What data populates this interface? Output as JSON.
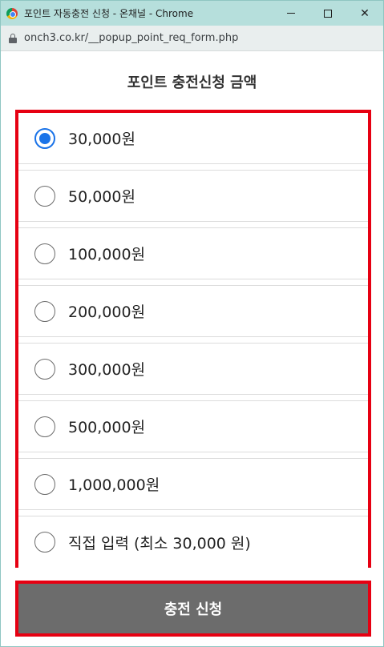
{
  "window": {
    "title": "포인트 자동충전 신청 - 온채널 - Chrome",
    "url": "onch3.co.kr/__popup_point_req_form.php"
  },
  "page": {
    "heading": "포인트 충전신청 금액",
    "options": [
      {
        "label": "30,000원",
        "checked": true
      },
      {
        "label": "50,000원",
        "checked": false
      },
      {
        "label": "100,000원",
        "checked": false
      },
      {
        "label": "200,000원",
        "checked": false
      },
      {
        "label": "300,000원",
        "checked": false
      },
      {
        "label": "500,000원",
        "checked": false
      },
      {
        "label": "1,000,000원",
        "checked": false
      },
      {
        "label": "직접 입력 (최소 30,000 원)",
        "checked": false
      }
    ],
    "submit_label": "충전 신청"
  },
  "colors": {
    "highlight_border": "#e60012",
    "radio_checked": "#1a73e8",
    "submit_bg": "#6c6c6c",
    "titlebar_bg": "#b6dfdc"
  },
  "icons": {
    "browser": "chrome-icon",
    "lock": "lock-icon",
    "minimize": "minimize-icon",
    "maximize": "maximize-icon",
    "close": "close-icon"
  }
}
